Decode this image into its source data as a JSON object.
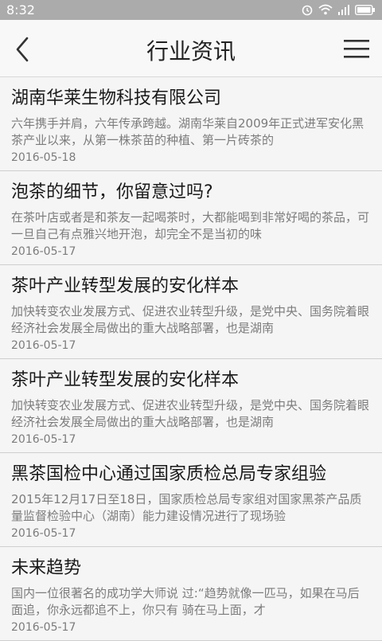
{
  "status": {
    "time": "8:32"
  },
  "header": {
    "title": "行业资讯"
  },
  "articles": [
    {
      "title": "湖南华莱生物科技有限公司",
      "summary": "六年携手并肩，六年传承跨越。湖南华莱自2009年正式进军安化黑茶产业以来，从第一株茶苗的种植、第一片砖茶的",
      "date": "2016-05-18"
    },
    {
      "title": "泡茶的细节，你留意过吗?",
      "summary": "在茶叶店或者是和茶友一起喝茶时，大都能喝到非常好喝的茶品，可一旦自己有点雅兴地开泡，却完全不是当初的味",
      "date": "2016-05-17"
    },
    {
      "title": "茶叶产业转型发展的安化样本",
      "summary": "加快转变农业发展方式、促进农业转型升级，是党中央、国务院着眼经济社会发展全局做出的重大战略部署，也是湖南",
      "date": "2016-05-17"
    },
    {
      "title": "茶叶产业转型发展的安化样本",
      "summary": "加快转变农业发展方式、促进农业转型升级，是党中央、国务院着眼经济社会发展全局做出的重大战略部署，也是湖南",
      "date": "2016-05-17"
    },
    {
      "title": "黑茶国检中心通过国家质检总局专家组验",
      "summary": "2015年12月17日至18日，国家质检总局专家组对国家黑茶产品质量监督检验中心（湖南）能力建设情况进行了现场验",
      "date": "2016-05-17"
    },
    {
      "title": "未来趋势",
      "summary": "国内一位很著名的成功学大师说 过:“趋势就像一匹马，如果在马后面追，你永远都追不上，你只有 骑在马上面，才",
      "date": "2016-05-17"
    }
  ]
}
